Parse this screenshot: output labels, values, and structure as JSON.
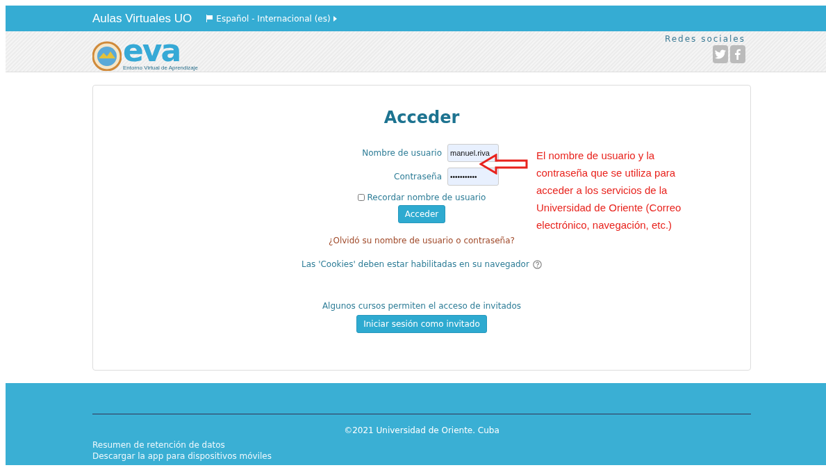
{
  "navbar": {
    "site_name": "Aulas Virtuales UO",
    "language": "Español - Internacional (es)"
  },
  "header": {
    "logo": {
      "word": "eva",
      "tagline": "Entorno Virtual de Aprendizaje"
    },
    "social": {
      "title": "Redes sociales"
    }
  },
  "login": {
    "title": "Acceder",
    "fields": [
      {
        "label": "Nombre de usuario",
        "kind": "text",
        "value": "manuel.riva"
      },
      {
        "label": "Contraseña",
        "kind": "password",
        "value": "•••••••••••"
      }
    ],
    "remember": {
      "label": "Recordar nombre de usuario",
      "checked": false
    },
    "submit": "Acceder",
    "forgot": "¿Olvidó su nombre de usuario o contraseña?",
    "cookies": "Las 'Cookies' deben estar habilitadas en su navegador",
    "guest_note": "Algunos cursos permiten el acceso de invitados",
    "guest_button": "Iniciar sesión como invitado"
  },
  "annotation": "El nombre de usuario y la contraseña que se utiliza para acceder a los servicios de la Universidad de Oriente (Correo electrónico, navegación, etc.)",
  "footer": {
    "copyright": "©2021 Universidad de Oriente. Cuba",
    "links": [
      "Resumen de retención de datos",
      "Descargar la app para dispositivos móviles"
    ]
  }
}
